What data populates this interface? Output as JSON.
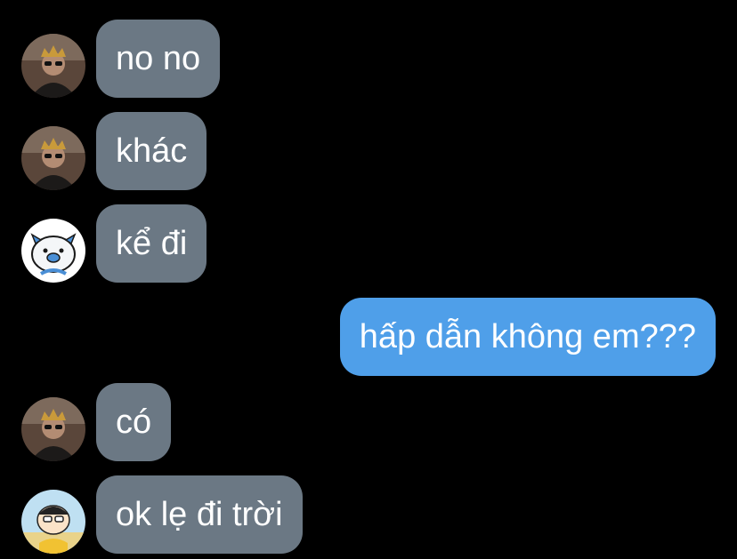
{
  "colors": {
    "background": "#000000",
    "incoming_bubble": "#6b7884",
    "outgoing_bubble": "#4f9fe9",
    "text": "#ffffff"
  },
  "messages": [
    {
      "direction": "incoming",
      "sender_avatar": "photo-avatar-crown-sunglasses",
      "text": "no no"
    },
    {
      "direction": "incoming",
      "sender_avatar": "photo-avatar-crown-sunglasses",
      "text": "khác"
    },
    {
      "direction": "incoming",
      "sender_avatar": "cartoon-avatar-white-pig",
      "text": "kể đi"
    },
    {
      "direction": "outgoing",
      "text": "hấp dẫn không em???"
    },
    {
      "direction": "incoming",
      "sender_avatar": "photo-avatar-crown-sunglasses",
      "text": "có"
    },
    {
      "direction": "incoming",
      "sender_avatar": "cartoon-avatar-shinchan",
      "text": "ok lẹ đi trời"
    }
  ]
}
